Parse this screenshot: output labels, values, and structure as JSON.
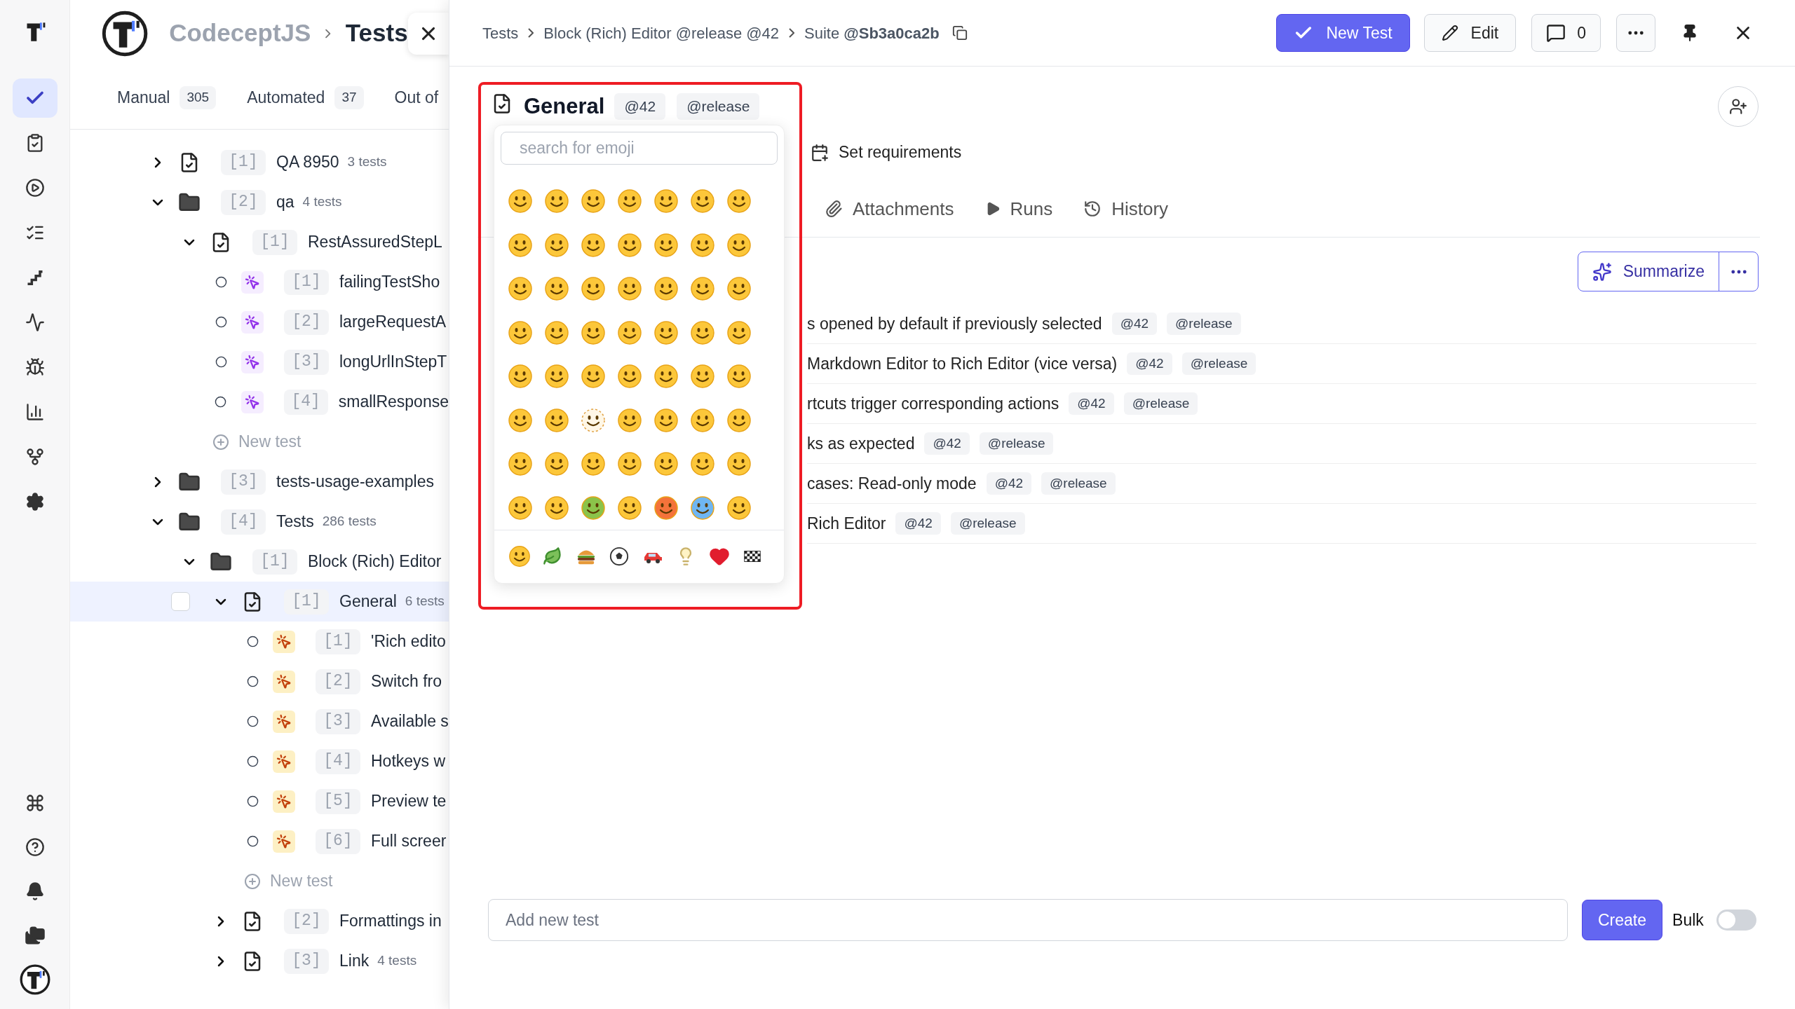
{
  "rail": {
    "items": [
      {
        "kind": "tests",
        "selected": true
      },
      {
        "kind": "plans",
        "selected": false
      },
      {
        "kind": "runs",
        "selected": false
      },
      {
        "kind": "checklists",
        "selected": false
      },
      {
        "kind": "steps",
        "selected": false
      },
      {
        "kind": "pulse",
        "selected": false
      },
      {
        "kind": "defects",
        "selected": false
      },
      {
        "kind": "analytics",
        "selected": false
      },
      {
        "kind": "branches",
        "selected": false
      },
      {
        "kind": "settings",
        "selected": false
      }
    ],
    "bottom_items": [
      {
        "kind": "commands"
      },
      {
        "kind": "help"
      },
      {
        "kind": "notifications"
      },
      {
        "kind": "projects"
      },
      {
        "kind": "account"
      }
    ]
  },
  "project": {
    "name": "CodeceptJS",
    "page": "Tests"
  },
  "tree_tabs": [
    {
      "label": "Manual",
      "count": "305"
    },
    {
      "label": "Automated",
      "count": "37"
    },
    {
      "label": "Out of"
    }
  ],
  "tree": [
    {
      "kind": "suite",
      "index": "[1]",
      "name": "QA 8950",
      "count": "3 tests",
      "expanded": false,
      "selected": false
    },
    {
      "kind": "folder",
      "index": "[2]",
      "name": "qa",
      "count": "4 tests",
      "expanded": true,
      "selected": false,
      "children": [
        {
          "kind": "suite",
          "index": "[1]",
          "name": "RestAssuredStepL",
          "expanded": true,
          "selected": false,
          "new_test": "New test",
          "children": [
            {
              "kind": "automated",
              "index": "[1]",
              "name": "failingTestSho",
              "selected": false
            },
            {
              "kind": "automated",
              "index": "[2]",
              "name": "largeRequestA",
              "selected": false
            },
            {
              "kind": "automated",
              "index": "[3]",
              "name": "longUrlInStepT",
              "selected": false
            },
            {
              "kind": "automated",
              "index": "[4]",
              "name": "smallResponse",
              "selected": false
            }
          ]
        }
      ]
    },
    {
      "kind": "folder",
      "index": "[3]",
      "name": "tests-usage-examples",
      "expanded": false,
      "selected": false
    },
    {
      "kind": "folder",
      "index": "[4]",
      "name": "Tests",
      "count": "286 tests",
      "expanded": true,
      "selected": false,
      "children": [
        {
          "kind": "folder",
          "index": "[1]",
          "name": "Block (Rich) Editor",
          "expanded": true,
          "selected": false,
          "children": [
            {
              "kind": "suite",
              "index": "[1]",
              "name": "General",
              "count": "6 tests",
              "expanded": true,
              "selected": true,
              "checked": false,
              "new_test": "New test",
              "children": [
                {
                  "kind": "manual",
                  "index": "[1]",
                  "name": "'Rich edito",
                  "selected": false
                },
                {
                  "kind": "manual",
                  "index": "[2]",
                  "name": "Switch fro",
                  "selected": false
                },
                {
                  "kind": "manual",
                  "index": "[3]",
                  "name": "Available s",
                  "selected": false
                },
                {
                  "kind": "manual",
                  "index": "[4]",
                  "name": "Hotkeys w",
                  "selected": false
                },
                {
                  "kind": "manual",
                  "index": "[5]",
                  "name": "Preview te",
                  "selected": false
                },
                {
                  "kind": "manual",
                  "index": "[6]",
                  "name": "Full screer",
                  "selected": false
                }
              ]
            },
            {
              "kind": "suite",
              "index": "[2]",
              "name": "Formattings in",
              "expanded": false,
              "selected": false
            },
            {
              "kind": "suite",
              "index": "[3]",
              "name": "Link",
              "count": "4 tests",
              "expanded": false,
              "selected": false
            }
          ]
        }
      ]
    }
  ],
  "breadcrumb": [
    "Tests",
    "Block (Rich) Editor @release @42",
    "Suite **@Sb3a0ca2b**"
  ],
  "toolbar": {
    "new_test": "New Test",
    "edit": "Edit",
    "comments": "0"
  },
  "suite": {
    "title": "General",
    "tags": [
      "@42",
      "@release"
    ]
  },
  "requirements_label": "Set requirements",
  "emoji_picker": {
    "placeholder": "search for emoji"
  },
  "tabs": [
    {
      "label": "Attachments",
      "kind": "attachments",
      "selected": false
    },
    {
      "label": "Runs",
      "kind": "runs",
      "selected": false
    },
    {
      "label": "History",
      "kind": "history",
      "selected": false
    }
  ],
  "summarize": "Summarize",
  "tests": [
    {
      "text": "s opened by default if previously selected",
      "tags": [
        "@42",
        "@release"
      ]
    },
    {
      "text": "Markdown Editor to Rich Editor (vice versa)",
      "tags": [
        "@42",
        "@release"
      ]
    },
    {
      "text": "rtcuts trigger corresponding actions",
      "tags": [
        "@42",
        "@release"
      ]
    },
    {
      "text": "ks as expected",
      "tags": [
        "@42",
        "@release"
      ]
    },
    {
      "text": "cases: Read-only mode",
      "tags": [
        "@42",
        "@release"
      ]
    },
    {
      "text": "Rich Editor",
      "tags": [
        "@42",
        "@release"
      ]
    }
  ],
  "add_test": {
    "placeholder": "Add new test",
    "button": "Create",
    "bulk_label": "Bulk",
    "bulk_on": false
  }
}
